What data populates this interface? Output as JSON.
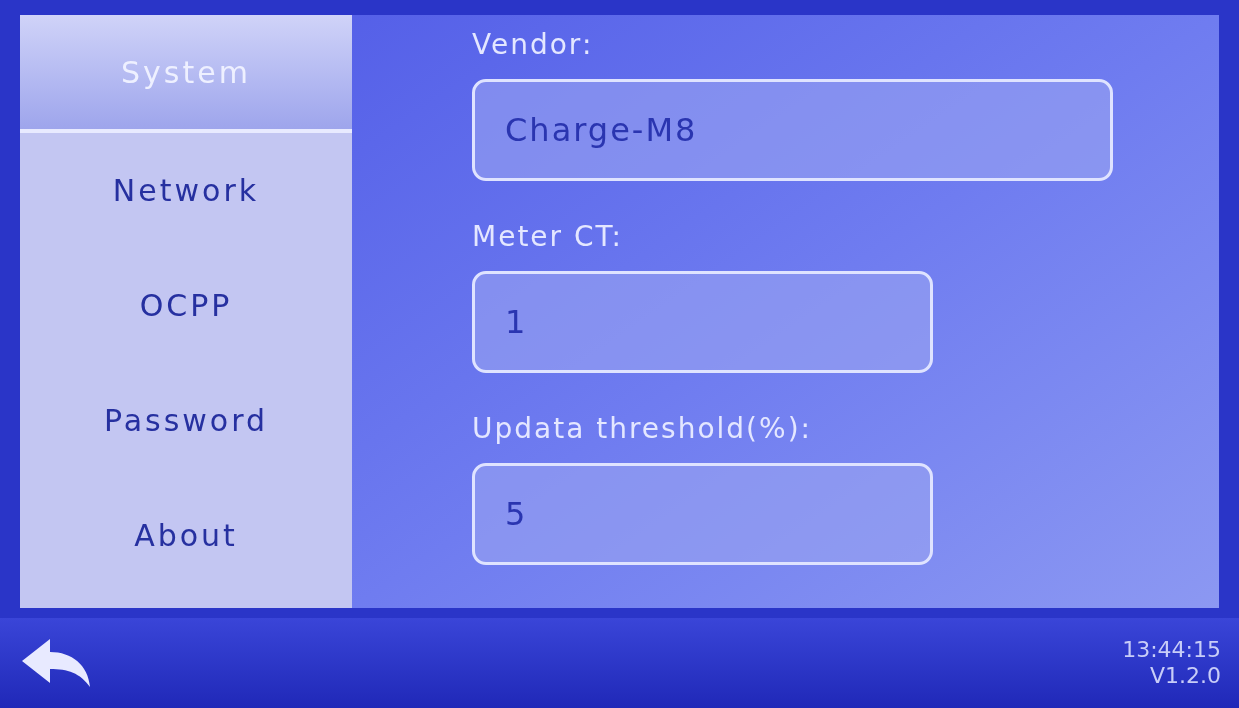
{
  "sidebar": {
    "items": [
      {
        "label": "System",
        "selected": true
      },
      {
        "label": "Network",
        "selected": false
      },
      {
        "label": "OCPP",
        "selected": false
      },
      {
        "label": "Password",
        "selected": false
      },
      {
        "label": "About",
        "selected": false
      }
    ]
  },
  "fields": [
    {
      "label": "Vendor:",
      "value": "Charge-M8",
      "kind": "wide"
    },
    {
      "label": "Meter CT:",
      "value": "1",
      "kind": "narrow"
    },
    {
      "label": "Updata threshold(%):",
      "value": "5",
      "kind": "narrow"
    }
  ],
  "status_bar": {
    "time": "13:44:15",
    "version": "V1.2.0"
  }
}
